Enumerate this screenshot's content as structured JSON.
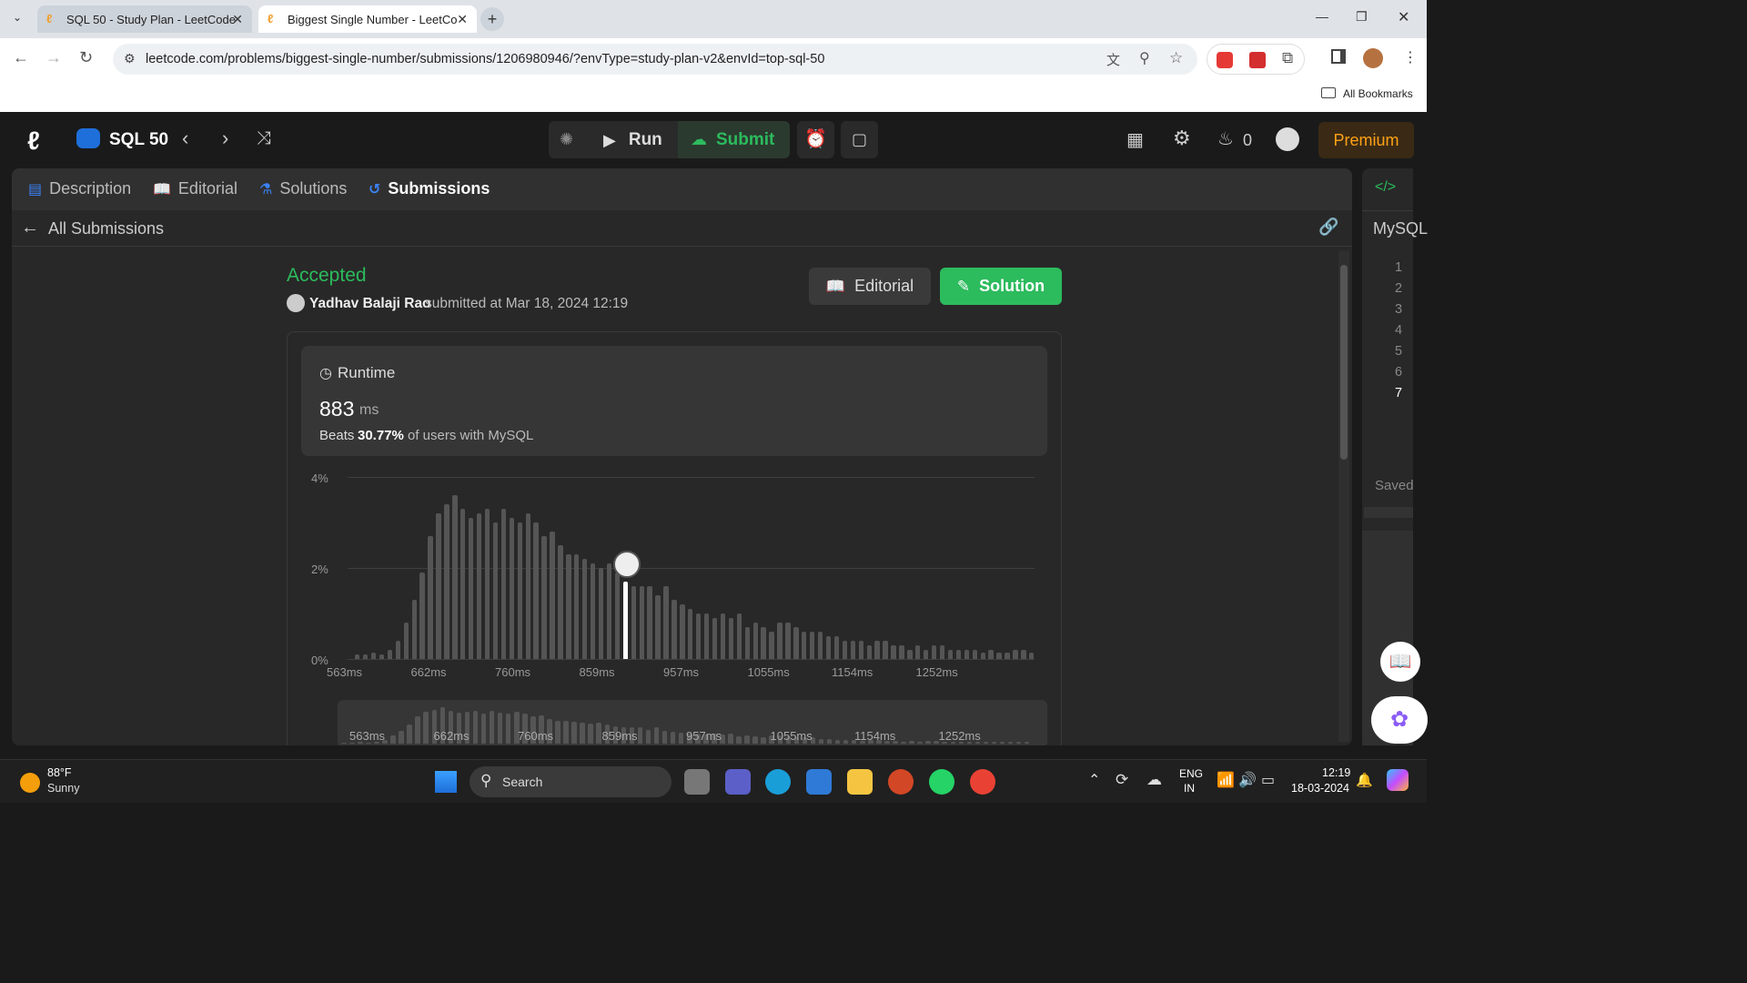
{
  "browser": {
    "tabs": [
      {
        "title": "SQL 50 - Study Plan - LeetCode",
        "active": false
      },
      {
        "title": "Biggest Single Number - LeetCo",
        "active": true
      }
    ],
    "url": "leetcode.com/problems/biggest-single-number/submissions/1206980946/?envType=study-plan-v2&envId=top-sql-50",
    "bookmarks_label": "All Bookmarks"
  },
  "header": {
    "study_plan": "SQL 50",
    "run_label": "Run",
    "submit_label": "Submit",
    "streak": "0",
    "premium_label": "Premium"
  },
  "panel_tabs": {
    "description": "Description",
    "editorial": "Editorial",
    "solutions": "Solutions",
    "submissions": "Submissions"
  },
  "submission": {
    "back_label": "All Submissions",
    "status": "Accepted",
    "user": "Yadhav Balaji Rao",
    "submitted_text": "submitted at Mar 18, 2024 12:19",
    "editorial_button": "Editorial",
    "solution_button": "Solution",
    "runtime_label": "Runtime",
    "runtime_value": "883",
    "runtime_unit": "ms",
    "beats_prefix": "Beats",
    "beats_percent": "30.77%",
    "beats_suffix": "of users with MySQL"
  },
  "chart_data": {
    "type": "bar",
    "ylabels": [
      "4%",
      "2%",
      "0%"
    ],
    "ylim": [
      0,
      4
    ],
    "xticks": [
      "563ms",
      "662ms",
      "760ms",
      "859ms",
      "957ms",
      "1055ms",
      "1154ms",
      "1252ms"
    ],
    "values": [
      0.1,
      0.1,
      0.15,
      0.1,
      0.2,
      0.4,
      0.8,
      1.3,
      1.9,
      2.7,
      3.2,
      3.4,
      3.6,
      3.3,
      3.1,
      3.2,
      3.3,
      3.0,
      3.3,
      3.1,
      3.0,
      3.2,
      3.0,
      2.7,
      2.8,
      2.5,
      2.3,
      2.3,
      2.2,
      2.1,
      2.0,
      2.1,
      1.9,
      1.7,
      1.6,
      1.6,
      1.6,
      1.4,
      1.6,
      1.3,
      1.2,
      1.1,
      1.0,
      1.0,
      0.9,
      1.0,
      0.9,
      1.0,
      0.7,
      0.8,
      0.7,
      0.6,
      0.8,
      0.8,
      0.7,
      0.6,
      0.6,
      0.6,
      0.5,
      0.5,
      0.4,
      0.4,
      0.4,
      0.3,
      0.4,
      0.4,
      0.3,
      0.3,
      0.2,
      0.3,
      0.2,
      0.3,
      0.3,
      0.2,
      0.2,
      0.2,
      0.2,
      0.15,
      0.2,
      0.15,
      0.15,
      0.2,
      0.2,
      0.15
    ],
    "highlight_index": 33,
    "highlight_x": "883ms"
  },
  "editor": {
    "language": "MySQL",
    "line_numbers": [
      "1",
      "2",
      "3",
      "4",
      "5",
      "6",
      "7"
    ],
    "saved_label": "Saved"
  },
  "taskbar": {
    "weather_temp": "88°F",
    "weather_desc": "Sunny",
    "search_label": "Search",
    "lang_top": "ENG",
    "lang_bottom": "IN",
    "time": "12:19",
    "date": "18-03-2024"
  },
  "colors": {
    "accepted_green": "#2cbb5d",
    "solution_green": "#2cbb5d",
    "premium_gold": "#ffa116",
    "submit_green": "#2cbb5d"
  }
}
